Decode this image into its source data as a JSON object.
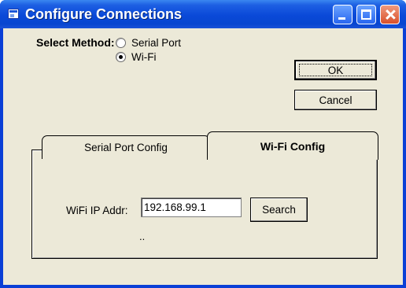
{
  "window": {
    "title": "Configure Connections"
  },
  "method": {
    "label": "Select Method:",
    "options": [
      {
        "label": "Serial Port",
        "checked": false
      },
      {
        "label": "Wi-Fi",
        "checked": true
      }
    ]
  },
  "buttons": {
    "ok": "OK",
    "cancel": "Cancel",
    "search": "Search"
  },
  "tabs": [
    {
      "label": "Serial Port Config",
      "active": false
    },
    {
      "label": "Wi-Fi Config",
      "active": true
    }
  ],
  "wifi": {
    "ip_label": "WiFi IP Addr:",
    "ip_value": "192.168.99.1",
    "status": ".."
  }
}
